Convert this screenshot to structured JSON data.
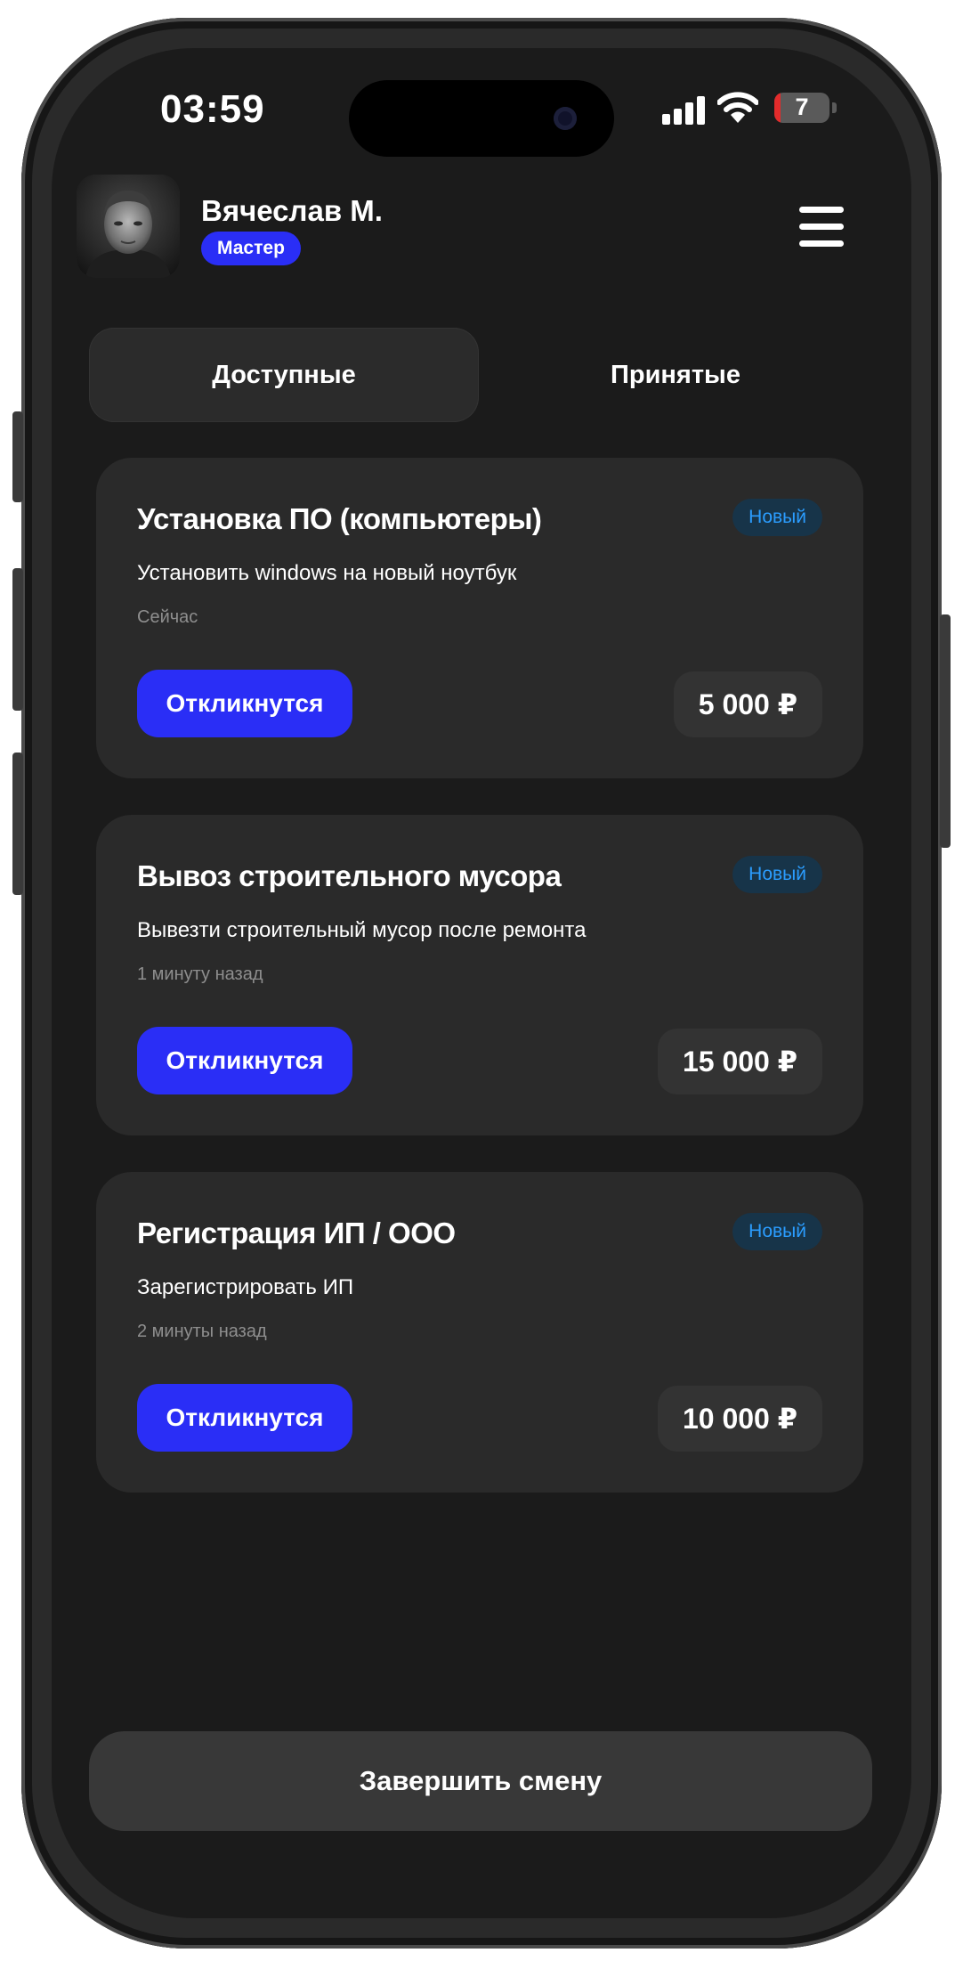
{
  "status_bar": {
    "time": "03:59",
    "battery_level": "7",
    "battery_fraction": 0.07
  },
  "header": {
    "user_name": "Вячеслав М.",
    "role": "Мастер"
  },
  "tabs": [
    {
      "label": "Доступные",
      "active": true
    },
    {
      "label": "Принятые",
      "active": false
    }
  ],
  "orders": [
    {
      "title": "Установка ПО (компьютеры)",
      "status": "Новый",
      "description": "Установить windows на новый ноутбук",
      "time": "Сейчас",
      "action_label": "Откликнутся",
      "price": "5 000 ₽"
    },
    {
      "title": "Вывоз строительного мусора",
      "status": "Новый",
      "description": "Вывезти строительный мусор после ремонта",
      "time": "1 минуту назад",
      "action_label": "Откликнутся",
      "price": "15 000 ₽"
    },
    {
      "title": "Регистрация ИП / ООО",
      "status": "Новый",
      "description": "Зарегистрировать ИП",
      "time": "2 минуты назад",
      "action_label": "Откликнутся",
      "price": "10 000 ₽"
    }
  ],
  "footer": {
    "end_shift_label": "Завершить смену"
  },
  "colors": {
    "accent": "#2a2ef6",
    "badge_text": "#2b9dff",
    "background": "#1b1b1b",
    "card": "#2a2a2a"
  },
  "icons": [
    "signal-icon",
    "wifi-icon",
    "battery-icon",
    "menu-icon",
    "avatar-photo"
  ]
}
